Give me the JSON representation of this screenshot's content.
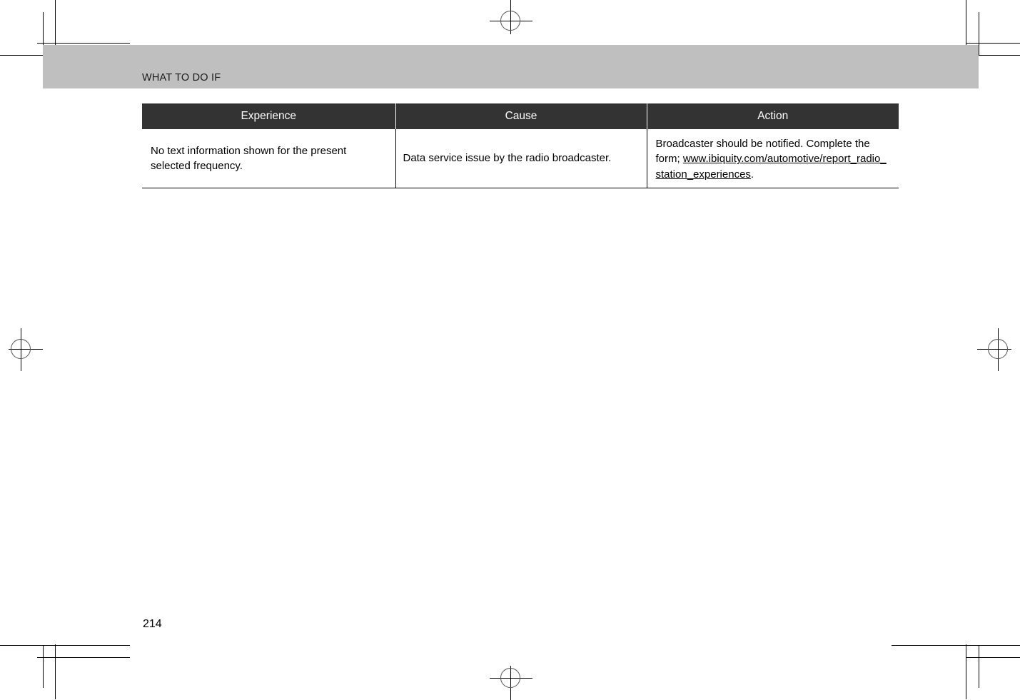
{
  "document": {
    "header_title": "WHAT TO DO IF",
    "page_number": "214"
  },
  "table": {
    "columns": [
      {
        "key": "experience",
        "label": "Experience"
      },
      {
        "key": "cause",
        "label": "Cause"
      },
      {
        "key": "action",
        "label": "Action"
      }
    ],
    "rows": [
      {
        "experience": "No text information shown for the present selected frequency.",
        "cause": "Data service issue by the radio broadcaster.",
        "action_text_before": "Broadcaster should be notified. Complete the form; ",
        "action_link": "www.ibiquity.com/automotive/report_radio_station_experiences",
        "action_text_after": "."
      }
    ]
  },
  "colors": {
    "header_band": "#bfbfbf",
    "table_header_bg": "#333333",
    "table_header_text": "#ffffff",
    "body_text": "#000000",
    "page_background": "#ffffff"
  }
}
